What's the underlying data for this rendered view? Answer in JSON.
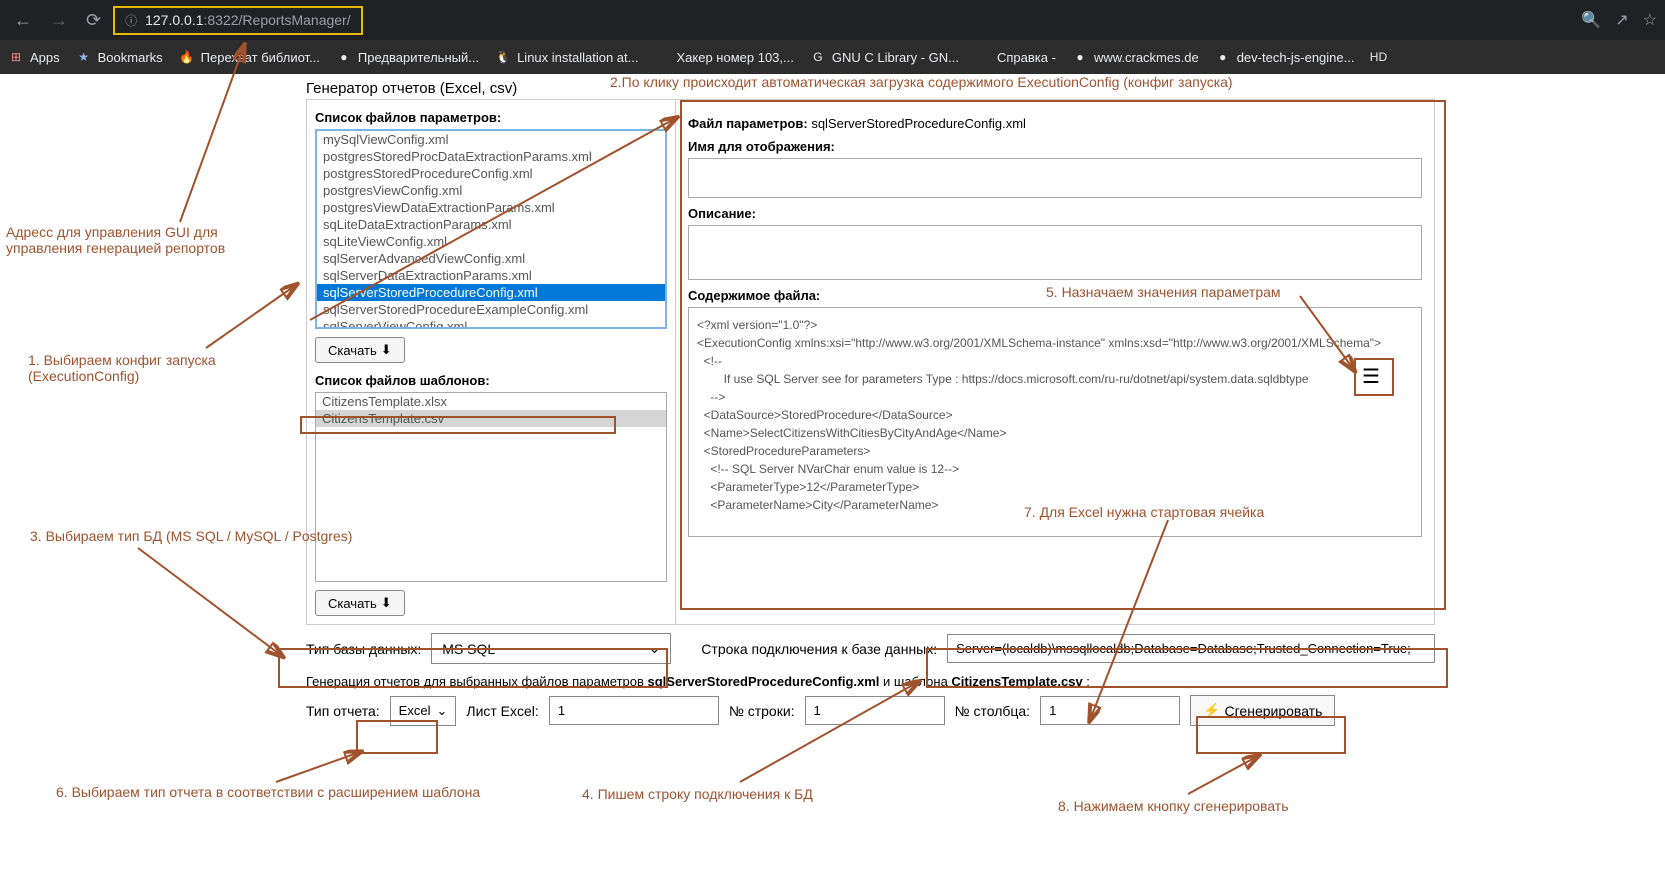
{
  "browser": {
    "url_prefix": "127.0.0.1",
    "url_port": ":8322",
    "url_path": "/ReportsManager/",
    "bookmarks": [
      {
        "icon": "grid",
        "label": "Apps"
      },
      {
        "icon": "star",
        "label": "Bookmarks"
      },
      {
        "icon": "ff",
        "label": "Перехват библиот..."
      },
      {
        "icon": "circle",
        "label": "Предварительный..."
      },
      {
        "icon": "tux",
        "label": "Linux installation at..."
      },
      {
        "icon": "blank",
        "label": "Хакер номер 103,..."
      },
      {
        "icon": "g",
        "label": "GNU C Library - GN..."
      },
      {
        "icon": "blank",
        "label": "Справка -"
      },
      {
        "icon": "circle",
        "label": "www.crackmes.de"
      },
      {
        "icon": "circle",
        "label": "dev-tech-js-engine..."
      },
      {
        "icon": "hd",
        "label": ""
      }
    ]
  },
  "page_title": "Генератор отчетов (Excel, csv)",
  "left": {
    "params_label": "Список файлов параметров:",
    "params_list": [
      "mySqlViewConfig.xml",
      "postgresStoredProcDataExtractionParams.xml",
      "postgresStoredProcedureConfig.xml",
      "postgresViewConfig.xml",
      "postgresViewDataExtractionParams.xml",
      "sqLiteDataExtractionParams.xml",
      "sqLiteViewConfig.xml",
      "sqlServerAdvancedViewConfig.xml",
      "sqlServerDataExtractionParams.xml",
      "sqlServerStoredProcedureConfig.xml",
      "sqlServerStoredProcedureExampleConfig.xml",
      "sqlServerViewConfig.xml"
    ],
    "params_selected_index": 9,
    "download_btn": "Скачать",
    "templates_label": "Список файлов шаблонов:",
    "templates_list": [
      "CitizensTemplate.xlsx",
      "CitizensTemplate.csv"
    ],
    "templates_selected_index": 1
  },
  "right": {
    "file_label": "Файл параметров:",
    "file_value": "sqlServerStoredProcedureConfig.xml",
    "display_name_label": "Имя для отображения:",
    "display_name_value": "",
    "description_label": "Описание:",
    "description_value": "",
    "content_label": "Содержимое файла:",
    "content_value": "<?xml version=\"1.0\"?>\n<ExecutionConfig xmlns:xsi=\"http://www.w3.org/2001/XMLSchema-instance\" xmlns:xsd=\"http://www.w3.org/2001/XMLSchema\">\n  <!--\n        If use SQL Server see for parameters Type : https://docs.microsoft.com/ru-ru/dotnet/api/system.data.sqldbtype\n    -->\n  <DataSource>StoredProcedure</DataSource>\n  <Name>SelectCitizensWithCitiesByCityAndAge</Name>\n  <StoredProcedureParameters>\n    <!-- SQL Server NVarChar enum value is 12-->\n    <ParameterType>12</ParameterType>\n    <ParameterName>City</ParameterName>"
  },
  "bottom": {
    "db_type_label": "Тип базы данных:",
    "db_type_value": "MS SQL",
    "conn_label": "Строка подключения к базе данных:",
    "conn_value": "Server=(localdb)\\mssqllocaldb;Database=Database;Trusted_Connection=True;",
    "gen_text_pre": "Генерация отчетов для выбранных файлов параметров ",
    "gen_text_file": "sqlServerStoredProcedureConfig.xml",
    "gen_text_mid": " и шаблона ",
    "gen_text_tpl": "CitizensTemplate.csv",
    "gen_text_post": " :",
    "report_type_label": "Тип отчета:",
    "report_type_value": "Excel",
    "sheet_label": "Лист Excel:",
    "sheet_value": "1",
    "row_label": "№ строки:",
    "row_value": "1",
    "col_label": "№ столбца:",
    "col_value": "1",
    "generate_btn": "Сгенерировать"
  },
  "annotations": {
    "addr": "Адресс для управления GUI для управления генерацией репортов",
    "a1": "1. Выбираем конфиг запуска (ExecutionConfig)",
    "a2": "2.По клику происходит автоматическая загрузка содержимого ExecutionConfig (конфиг запуска)",
    "a3": "3. Выбираем тип БД (MS SQL / MySQL / Postgres)",
    "a4": "4. Пишем строку подключения к БД",
    "a5": "5. Назначаем значения параметрам",
    "a6": "6. Выбираем тип отчета в соответствии с расширением шаблона",
    "a7": "7. Для Excel нужна стартовая ячейка",
    "a8": "8. Нажимаем кнопку сгенерировать"
  }
}
